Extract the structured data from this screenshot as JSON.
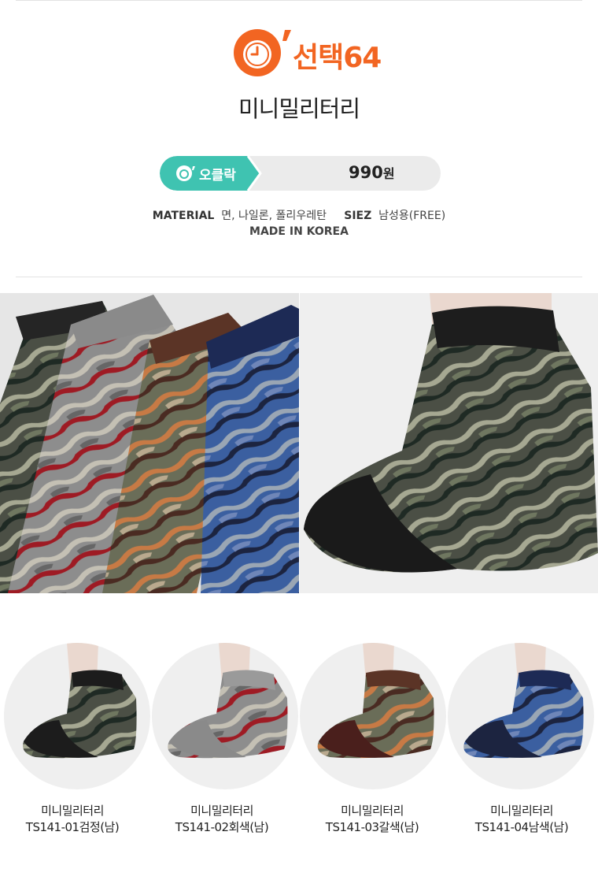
{
  "brand": {
    "logo_text": "선택64",
    "accent_color": "#f26522"
  },
  "product": {
    "name": "미니밀리터리"
  },
  "price": {
    "tag_label": "오클락",
    "tag_color": "#3fc3b1",
    "value": "990",
    "unit": "원"
  },
  "specs": {
    "material_label": "MATERIAL",
    "material_value": "면, 나일론, 폴리우레탄",
    "size_label": "SIEZ",
    "size_value": "남성용(FREE)",
    "origin": "MADE IN KOREA"
  },
  "variants": [
    {
      "name": "미니밀리터리",
      "code": "TS141-01검정(남)",
      "color": "#1c1c1c"
    },
    {
      "name": "미니밀리터리",
      "code": "TS141-02회색(남)",
      "color": "#9a9a9a"
    },
    {
      "name": "미니밀리터리",
      "code": "TS141-03갈색(남)",
      "color": "#5b3426"
    },
    {
      "name": "미니밀리터리",
      "code": "TS141-04남색(남)",
      "color": "#1d2a55"
    }
  ]
}
